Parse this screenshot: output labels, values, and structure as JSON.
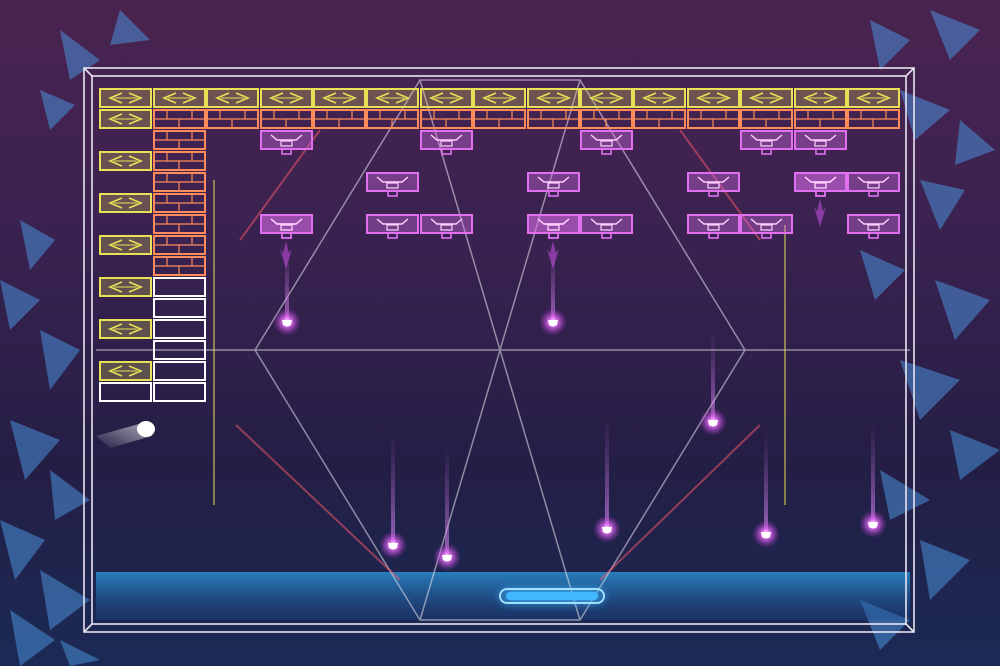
{
  "game": {
    "genre": "neon breakout",
    "colors": {
      "background_top": "#4a2350",
      "background_bottom": "#1a2a55",
      "frame": "#e8e4f0",
      "gold_brick": "#e8e055",
      "orange_brick": "#ff8a5a",
      "white_brick": "#ffffff",
      "turret_brick": "#e070f0",
      "paddle": "#3fb8ff",
      "projectile": "#f070ff",
      "ball": "#ffffff"
    },
    "icons": {
      "gold_brick": "double-chevron-icon",
      "orange_brick": "masonry-icon",
      "turret_brick": "cannon-icon",
      "projectile": "plasma-bolt-icon"
    }
  }
}
